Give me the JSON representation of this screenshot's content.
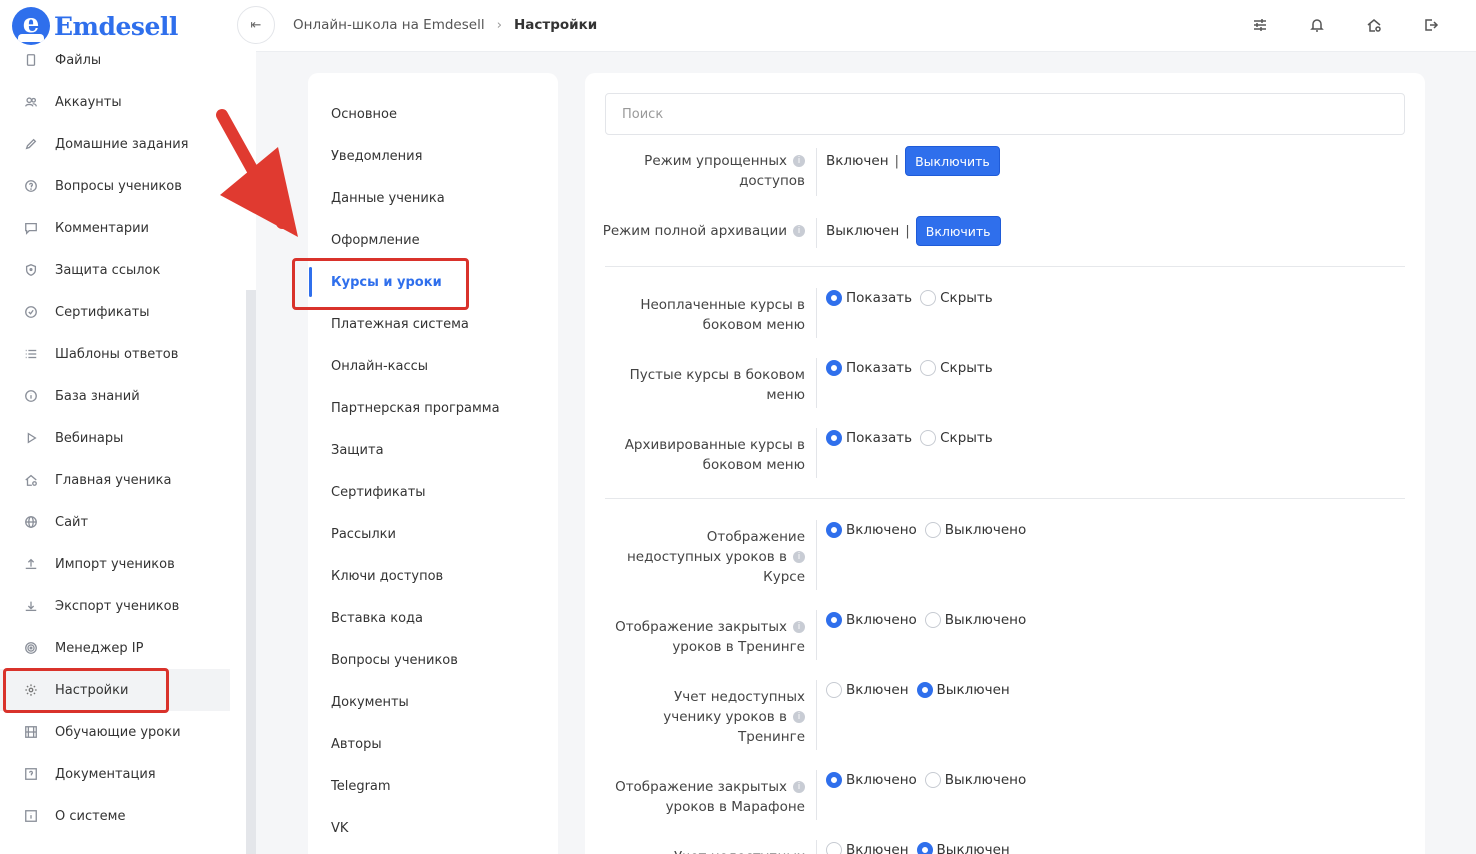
{
  "app": {
    "brand": "Emdesell",
    "logo_letter": "e"
  },
  "sidebar": {
    "items": [
      {
        "label": "Файлы",
        "icon": "file-icon"
      },
      {
        "label": "Аккаунты",
        "icon": "users-icon"
      },
      {
        "label": "Домашние задания",
        "icon": "pencil-icon"
      },
      {
        "label": "Вопросы учеников",
        "icon": "question-circle-icon"
      },
      {
        "label": "Комментарии",
        "icon": "comment-icon"
      },
      {
        "label": "Защита ссылок",
        "icon": "shield-icon"
      },
      {
        "label": "Сертификаты",
        "icon": "check-circle-icon"
      },
      {
        "label": "Шаблоны ответов",
        "icon": "list-icon"
      },
      {
        "label": "База знаний",
        "icon": "info-circle-icon"
      },
      {
        "label": "Вебинары",
        "icon": "play-icon"
      },
      {
        "label": "Главная ученика",
        "icon": "home-gear-icon"
      },
      {
        "label": "Сайт",
        "icon": "globe-icon"
      },
      {
        "label": "Импорт учеников",
        "icon": "upload-icon"
      },
      {
        "label": "Экспорт учеников",
        "icon": "download-icon"
      },
      {
        "label": "Менеджер IP",
        "icon": "target-icon"
      },
      {
        "label": "Настройки",
        "icon": "gear-icon"
      },
      {
        "label": "Обучающие уроки",
        "icon": "film-icon"
      },
      {
        "label": "Документация",
        "icon": "help-box-icon"
      },
      {
        "label": "О системе",
        "icon": "info-box-icon"
      }
    ],
    "active": "Настройки"
  },
  "header": {
    "collapse_icon": "collapse-left-icon",
    "breadcrumb": [
      "Онлайн-школа на Emdesell",
      "Настройки"
    ],
    "icons": [
      "sliders-icon",
      "bell-icon",
      "home-settings-icon",
      "logout-icon"
    ]
  },
  "settings_menu": {
    "items": [
      "Основное",
      "Уведомления",
      "Данные ученика",
      "Оформление",
      "Курсы и уроки",
      "Платежная система",
      "Онлайн-кассы",
      "Партнерская программа",
      "Защита",
      "Сертификаты",
      "Рассылки",
      "Ключи доступов",
      "Вставка кода",
      "Вопросы учеников",
      "Документы",
      "Авторы",
      "Telegram",
      "VK"
    ],
    "active": "Курсы и уроки"
  },
  "content": {
    "search_placeholder": "Поиск",
    "toggles": [
      {
        "label": [
          "Режим упрощенных",
          "доступов"
        ],
        "status": "Включен",
        "button": "Выключить"
      },
      {
        "label": [
          "Режим полной архивации"
        ],
        "status": "Выключен",
        "button": "Включить"
      }
    ],
    "menu_options": [
      {
        "label": [
          "Неоплаченные курсы в",
          "боковом меню"
        ],
        "options": [
          "Показать",
          "Скрыть"
        ],
        "selected": 0
      },
      {
        "label": [
          "Пустые курсы в боковом",
          "меню"
        ],
        "options": [
          "Показать",
          "Скрыть"
        ],
        "selected": 0
      },
      {
        "label": [
          "Архивированные курсы в",
          "боковом меню"
        ],
        "options": [
          "Показать",
          "Скрыть"
        ],
        "selected": 0
      }
    ],
    "lesson_options": [
      {
        "label": [
          "Отображение",
          "недоступных уроков в",
          "Курсе"
        ],
        "options": [
          "Включено",
          "Выключено"
        ],
        "selected": 0
      },
      {
        "label": [
          "Отображение закрытых",
          "уроков в Тренинге"
        ],
        "options": [
          "Включено",
          "Выключено"
        ],
        "selected": 0
      },
      {
        "label": [
          "Учет недоступных",
          "ученику уроков в",
          "Тренинге"
        ],
        "options": [
          "Включен",
          "Выключен"
        ],
        "selected": 1
      },
      {
        "label": [
          "Отображение закрытых",
          "уроков в Марафоне"
        ],
        "options": [
          "Включено",
          "Выключено"
        ],
        "selected": 0
      },
      {
        "label": [
          "Учет недоступных"
        ],
        "options": [
          "Включен",
          "Выключен"
        ],
        "selected": 1
      }
    ]
  },
  "colors": {
    "accent": "#2f6fec",
    "highlight": "#d9322b"
  }
}
